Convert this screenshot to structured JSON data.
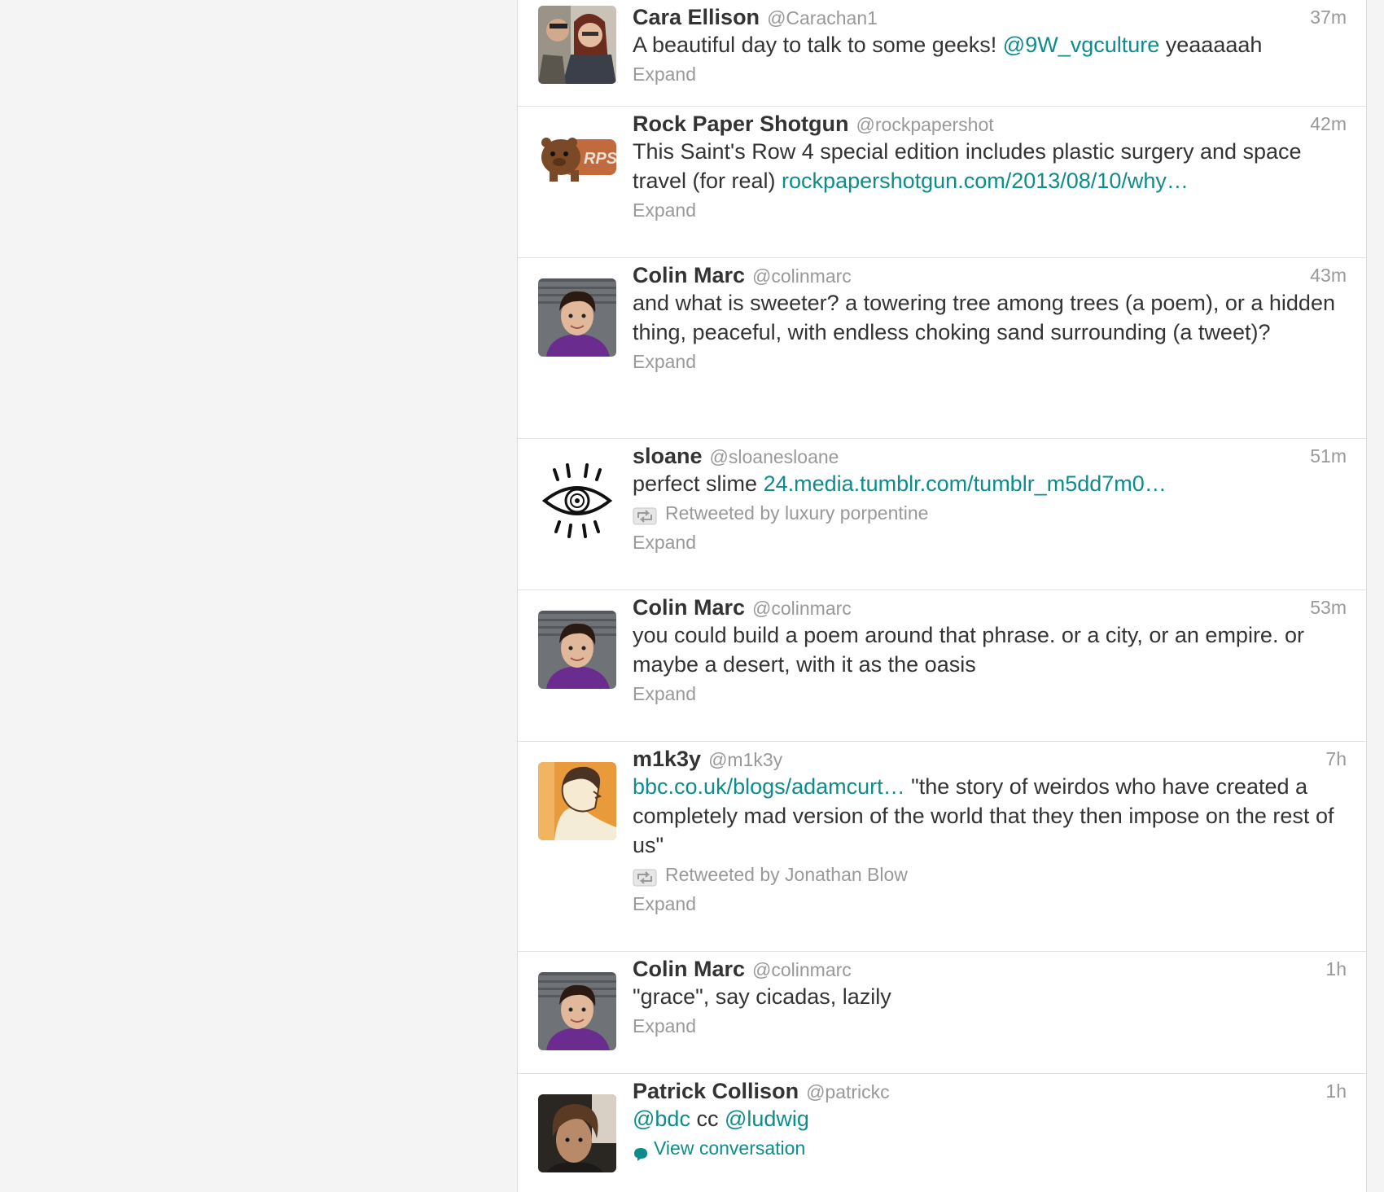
{
  "colors": {
    "link": "#0e8c8c",
    "muted": "#999999",
    "text": "#333333",
    "page_bg": "#f4f4f4"
  },
  "tweets": [
    {
      "name": "Cara Ellison",
      "handle": "@Carachan1",
      "time": "37m",
      "parts": [
        {
          "t": "A beautiful day to talk to some geeks! ",
          "link": false
        },
        {
          "t": "@9W_vgculture",
          "link": true
        },
        {
          "t": " yeaaaaah",
          "link": false
        }
      ],
      "action": "Expand"
    },
    {
      "name": "Rock Paper Shotgun",
      "handle": "@rockpapershot",
      "time": "42m",
      "parts": [
        {
          "t": "This Saint's Row 4 special edition includes plastic surgery and space travel (for real) ",
          "link": false
        },
        {
          "t": "rockpapershotgun.com/2013/08/10/why…",
          "link": true
        }
      ],
      "avatar_text": "RPS",
      "action": "Expand"
    },
    {
      "name": "Colin Marc",
      "handle": "@colinmarc",
      "time": "43m",
      "parts": [
        {
          "t": "and what is sweeter? a towering tree among trees (a poem), or a hidden thing, peaceful, with endless choking sand surrounding (a tweet)?",
          "link": false
        }
      ],
      "action": "Expand"
    },
    {
      "name": "sloane",
      "handle": "@sloanesloane",
      "time": "51m",
      "parts": [
        {
          "t": "perfect slime ",
          "link": false
        },
        {
          "t": "24.media.tumblr.com/tumblr_m5dd7m0…",
          "link": true
        }
      ],
      "retweeted_by": "Retweeted by luxury porpentine",
      "action": "Expand"
    },
    {
      "name": "Colin Marc",
      "handle": "@colinmarc",
      "time": "53m",
      "parts": [
        {
          "t": "you could build a poem around that phrase. or a city, or an empire. or maybe a desert, with it as the oasis",
          "link": false
        }
      ],
      "action": "Expand"
    },
    {
      "name": "m1k3y",
      "handle": "@m1k3y",
      "time": "7h",
      "parts": [
        {
          "t": "bbc.co.uk/blogs/adamcurt…",
          "link": true
        },
        {
          "t": " \"the story of weirdos who have created a completely mad version of the world that they then impose on the rest of us\"",
          "link": false
        }
      ],
      "retweeted_by": "Retweeted by Jonathan Blow",
      "action": "Expand"
    },
    {
      "name": "Colin Marc",
      "handle": "@colinmarc",
      "time": "1h",
      "parts": [
        {
          "t": "\"grace\", say cicadas, lazily",
          "link": false
        }
      ],
      "action": "Expand"
    },
    {
      "name": "Patrick Collison",
      "handle": "@patrickc",
      "time": "1h",
      "parts": [
        {
          "t": "@bdc",
          "link": true
        },
        {
          "t": " cc ",
          "link": false
        },
        {
          "t": "@ludwig",
          "link": true
        }
      ],
      "conversation": "View conversation"
    }
  ]
}
